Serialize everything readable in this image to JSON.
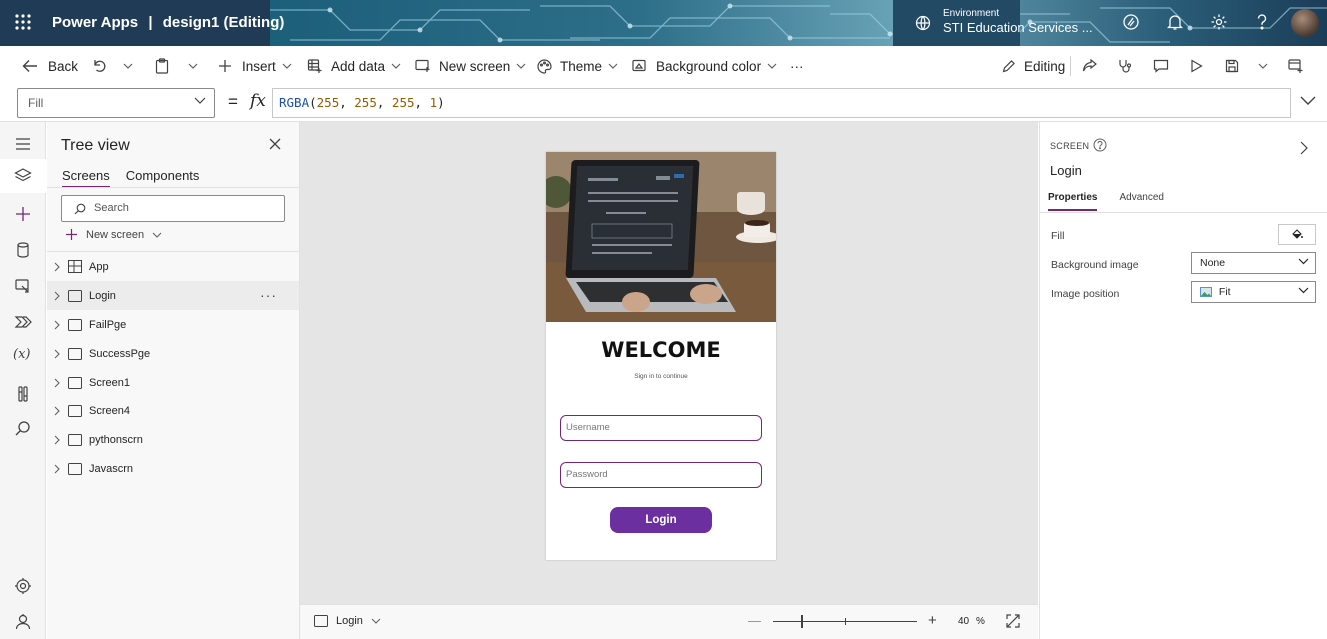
{
  "app": {
    "brand": "Power Apps",
    "separator": "|",
    "document": "design1 (Editing)"
  },
  "environment": {
    "label": "Environment",
    "value": "STI Education Services ..."
  },
  "toolbar": {
    "back": "Back",
    "insert": "Insert",
    "add_data": "Add data",
    "new_screen": "New screen",
    "theme": "Theme",
    "background_color": "Background color",
    "more": "···",
    "editing": "Editing"
  },
  "formula_bar": {
    "property": "Fill",
    "equals": "=",
    "fx": "fx",
    "formula_fn": "RGBA",
    "formula_open": "(",
    "r": "255",
    "g": "255",
    "b": "255",
    "a": "1",
    "formula_close": ")",
    "comma": ", "
  },
  "tree_view": {
    "title": "Tree view",
    "tabs": [
      "Screens",
      "Components"
    ],
    "search_placeholder": "Search",
    "new_screen": "New screen",
    "items": [
      "App",
      "Login",
      "FailPge",
      "SuccessPge",
      "Screen1",
      "Screen4",
      "pythonscrn",
      "Javascrn"
    ],
    "selected": "Login",
    "more": "···"
  },
  "screen": {
    "welcome": "WELCOME",
    "subtitle": "Sign in to continue",
    "username_placeholder": "Username",
    "password_placeholder": "Password",
    "login_button": "Login"
  },
  "status": {
    "screen": "Login",
    "zoom": "40",
    "zoom_unit": "%",
    "zoom_minus": "—",
    "zoom_plus": "+",
    "zoom_level": 0.4
  },
  "properties": {
    "kind": "SCREEN",
    "name": "Login",
    "tabs": [
      "Properties",
      "Advanced"
    ],
    "fill_label": "Fill",
    "background_image_label": "Background image",
    "background_image_value": "None",
    "image_position_label": "Image position",
    "image_position_value": "Fit"
  },
  "colors": {
    "accent": "#742774",
    "login_button": "#6b2fa0",
    "title_bar": "#1f3b56"
  }
}
